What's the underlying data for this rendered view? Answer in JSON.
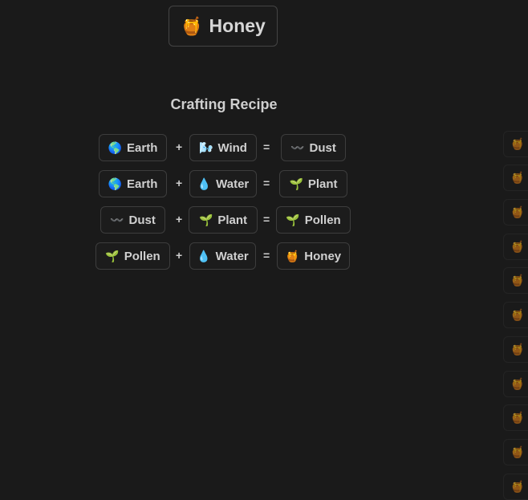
{
  "title": {
    "icon": "honey-pot-icon",
    "emoji": "🍯",
    "label": "Honey"
  },
  "recipe_heading": "Crafting Recipe",
  "recipes": [
    {
      "a": {
        "emoji": "🌎",
        "label": "Earth"
      },
      "op1": "+",
      "b": {
        "emoji": "🌬️",
        "label": "Wind"
      },
      "op2": "=",
      "result": {
        "emoji": "〰️",
        "label": "Dust"
      }
    },
    {
      "a": {
        "emoji": "🌎",
        "label": "Earth"
      },
      "op1": "+",
      "b": {
        "emoji": "💧",
        "label": "Water"
      },
      "op2": "=",
      "result": {
        "emoji": "🌱",
        "label": "Plant"
      }
    },
    {
      "a": {
        "emoji": "〰️",
        "label": "Dust"
      },
      "op1": "+",
      "b": {
        "emoji": "🌱",
        "label": "Plant"
      },
      "op2": "=",
      "result": {
        "emoji": "🌱",
        "label": "Pollen"
      }
    },
    {
      "a": {
        "emoji": "🌱",
        "label": "Pollen"
      },
      "op1": "+",
      "b": {
        "emoji": "💧",
        "label": "Water"
      },
      "op2": "=",
      "result": {
        "emoji": "🍯",
        "label": "Honey"
      }
    }
  ],
  "sidebar_items": [
    {
      "emoji": "🍯"
    },
    {
      "emoji": "🍯"
    },
    {
      "emoji": "🍯"
    },
    {
      "emoji": "🍯"
    },
    {
      "emoji": "🍯"
    },
    {
      "emoji": "🍯"
    },
    {
      "emoji": "🍯"
    },
    {
      "emoji": "🍯"
    },
    {
      "emoji": "🍯"
    },
    {
      "emoji": "🍯"
    },
    {
      "emoji": "🍯"
    }
  ]
}
